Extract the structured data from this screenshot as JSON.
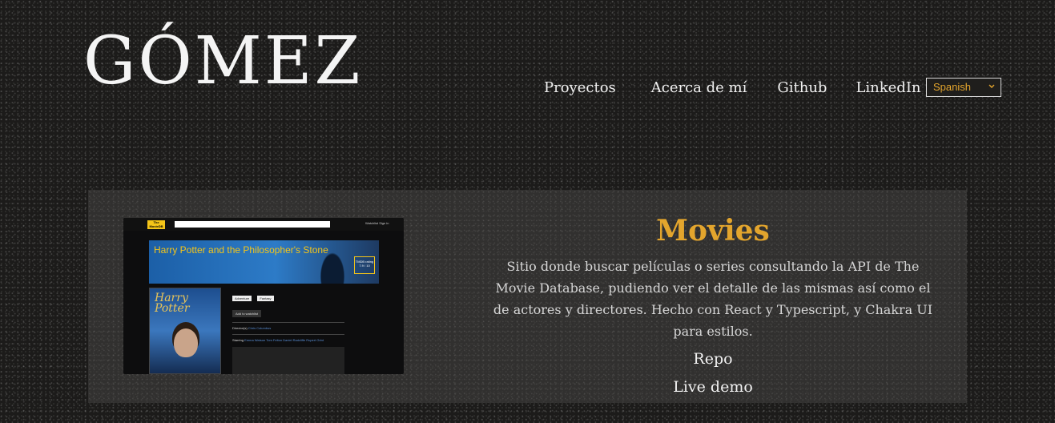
{
  "header": {
    "brand": "GÓMEZ",
    "nav": [
      {
        "label": "Proyectos"
      },
      {
        "label": "Acerca de mí"
      },
      {
        "label": "Github"
      },
      {
        "label": "LinkedIn"
      }
    ],
    "language_select": {
      "selected": "Spanish"
    }
  },
  "project": {
    "title": "Movies",
    "description": "Sitio donde buscar películas o series consultando la API de The Movie Database, pudiendo ver el detalle de las mismas así como el de actores y directores. Hecho con React y Typescript, y Chakra UI para estilos.",
    "links": {
      "repo": "Repo",
      "live_demo": "Live demo"
    },
    "screenshot": {
      "logo_text": "The MovieDB",
      "top_links": "Watchlist    Sign in",
      "movie_title": "Harry Potter and the Philosopher's Stone",
      "rating_label": "TMDB rating",
      "rating_value": "7.9 / 10",
      "poster_title": "Harry Potter",
      "tags": [
        "Adventure",
        "Fantasy"
      ],
      "watchlist_button": "Add to watchlist",
      "director_label": "Director(s)",
      "director_value": "Chris Columbus",
      "starring_label": "Starring",
      "starring_value": "Emma Watson   Tom Felton   Daniel Radcliffe   Rupert Grint"
    }
  },
  "colors": {
    "accent": "#e3a52d",
    "background": "#1c1b1a",
    "card": "#3a3937",
    "text": "#f2f2f2"
  }
}
